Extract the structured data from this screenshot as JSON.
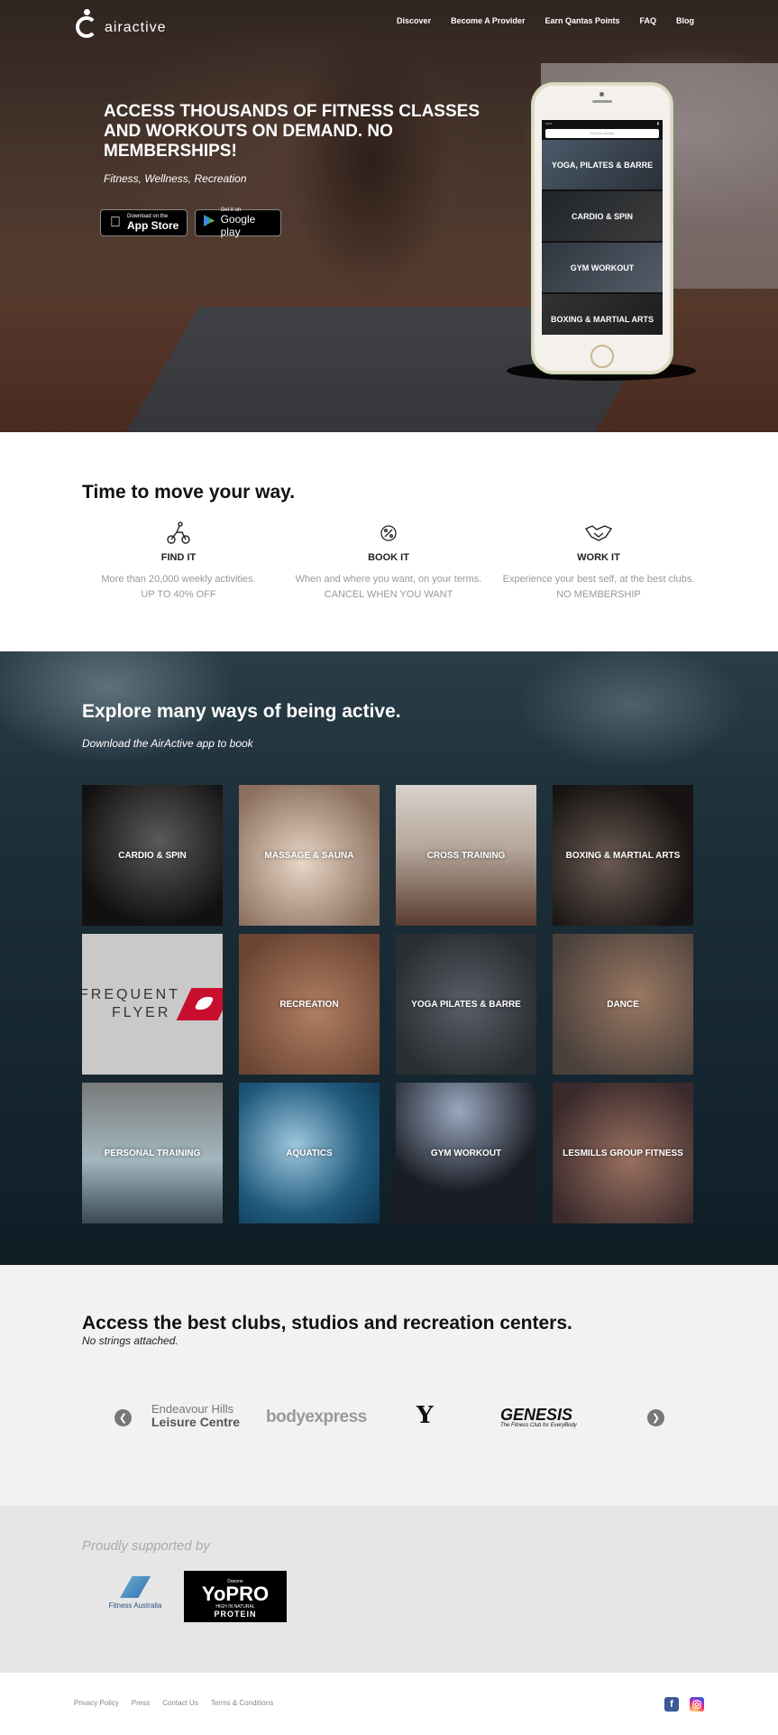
{
  "header": {
    "logo_text": "airactive",
    "nav": [
      "Discover",
      "Become A Provider",
      "Earn Qantas Points",
      "FAQ",
      "Blog"
    ]
  },
  "hero": {
    "title": "ACCESS THOUSANDS OF FITNESS CLASSES AND WORKOUTS ON DEMAND. NO MEMBERSHIPS!",
    "subtitle": "Fitness, Wellness, Recreation",
    "app_store": {
      "small": "Download on the",
      "big": "App Store"
    },
    "google_play": {
      "small": "Get it on",
      "big": "Google play"
    },
    "phone": {
      "search_placeholder": "Find an activity",
      "tiles": [
        "YOGA, PILATES & BARRE",
        "CARDIO & SPIN",
        "GYM WORKOUT",
        "BOXING & MARTIAL ARTS"
      ]
    }
  },
  "how": {
    "title": "Time to move your way.",
    "features": [
      {
        "icon": "bike-icon",
        "title": "FIND IT",
        "line1": "More than 20,000 weekly activities.",
        "line2": "UP TO 40% OFF"
      },
      {
        "icon": "percent-icon",
        "title": "BOOK IT",
        "line1": "When and where you want, on your terms.",
        "line2": "CANCEL WHEN YOU WANT"
      },
      {
        "icon": "handshake-icon",
        "title": "WORK IT",
        "line1": "Experience your best self, at the best clubs.",
        "line2": "NO MEMBERSHIP"
      }
    ]
  },
  "explore": {
    "title": "Explore many ways of being active.",
    "subtitle": "Download the AirActive app to book",
    "categories": [
      "CARDIO & SPIN",
      "MASSAGE & SAUNA",
      "CROSS TRAINING",
      "BOXING & MARTIAL ARTS",
      "",
      "RECREATION",
      "YOGA PILATES & BARRE",
      "DANCE",
      "PERSONAL TRAINING",
      "AQUATICS",
      "GYM WORKOUT",
      "LESMILLS GROUP FITNESS"
    ],
    "frequent_flyer": {
      "line1": "FREQUENT",
      "line2": "FLYER"
    }
  },
  "clubs": {
    "title": "Access the best clubs, studios and recreation centers.",
    "subtitle": "No strings attached.",
    "logos": {
      "endeavour_line1": "Endeavour Hills",
      "endeavour_line2": "Leisure Centre",
      "bodyexpress": "bodyexpress",
      "ymca": "Y",
      "genesis": "GENESIS",
      "genesis_tag": "The Fitness Club for EveryBody"
    }
  },
  "support": {
    "label": "Proudly supported by",
    "fitness_australia": "Fitness Australia",
    "yopro": {
      "small": "Danone",
      "big": "YoPRO",
      "tag": "HIGH IN NATURAL",
      "prot": "PROTEIN"
    }
  },
  "footer": {
    "links": [
      "Privacy Policy",
      "Press",
      "Contact Us",
      "Terms & Conditions"
    ]
  }
}
